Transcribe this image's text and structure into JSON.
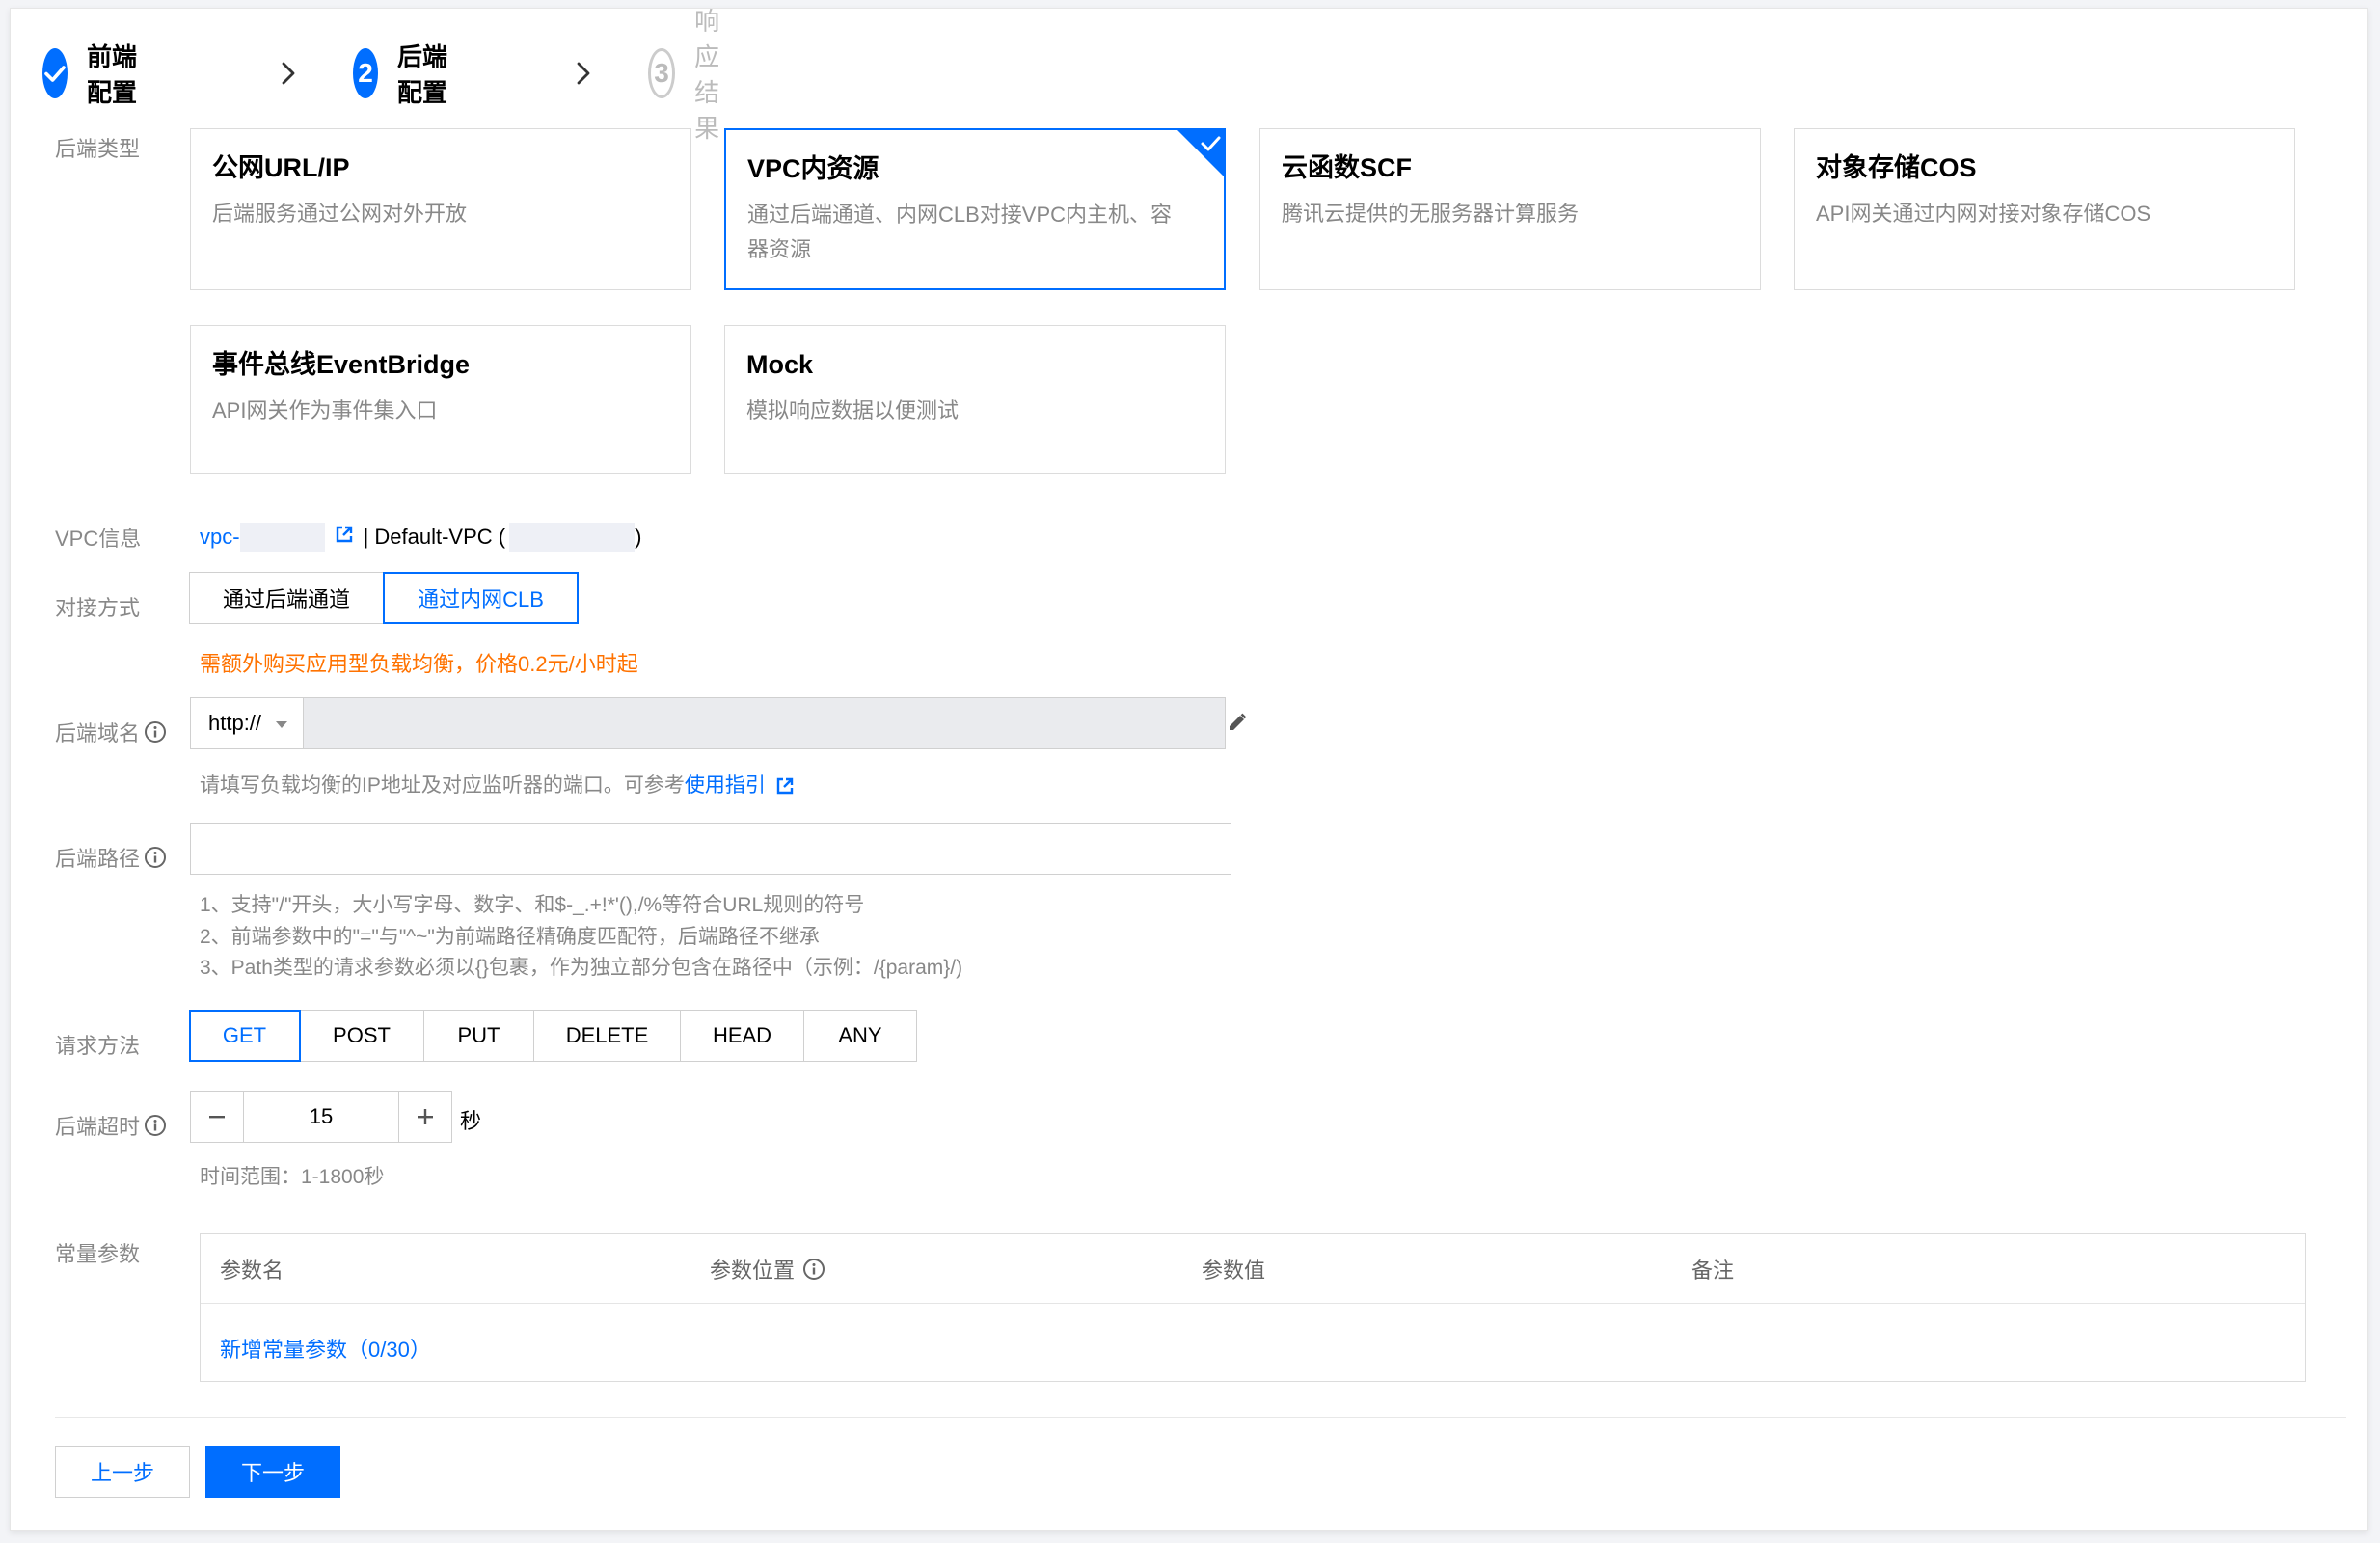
{
  "steps": [
    {
      "number": "",
      "label": "前端配置",
      "status": "done"
    },
    {
      "number": "2",
      "label": "后端配置",
      "status": "active"
    },
    {
      "number": "3",
      "label": "响应结果",
      "status": "pending"
    }
  ],
  "labels": {
    "backend_type": "后端类型",
    "vpc_info": "VPC信息",
    "connect_method": "对接方式",
    "backend_domain": "后端域名",
    "backend_path": "后端路径",
    "request_method": "请求方法",
    "backend_timeout": "后端超时",
    "constant_params": "常量参数"
  },
  "backend_types": [
    {
      "title": "公网URL/IP",
      "desc": "后端服务通过公网对外开放",
      "selected": false
    },
    {
      "title": "VPC内资源",
      "desc": "通过后端通道、内网CLB对接VPC内主机、容器资源",
      "selected": true
    },
    {
      "title": "云函数SCF",
      "desc": "腾讯云提供的无服务器计算服务",
      "selected": false
    },
    {
      "title": "对象存储COS",
      "desc": "API网关通过内网对接对象存储COS",
      "selected": false
    },
    {
      "title": "事件总线EventBridge",
      "desc": "API网关作为事件集入口",
      "selected": false
    },
    {
      "title": "Mock",
      "desc": "模拟响应数据以便测试",
      "selected": false
    }
  ],
  "vpc": {
    "id_prefix": "vpc-",
    "separator_name": "| Default-VPC (",
    "close_paren": ")"
  },
  "connect_methods": [
    {
      "label": "通过后端通道",
      "active": false
    },
    {
      "label": "通过内网CLB",
      "active": true
    }
  ],
  "connect_warning": "需额外购买应用型负载均衡，价格0.2元/小时起",
  "domain": {
    "protocol": "http://",
    "value": "",
    "help_prefix": "请填写负载均衡的IP地址及对应监听器的端口。可参考",
    "help_link": "使用指引"
  },
  "path": {
    "value": "",
    "help": [
      "1、支持\"/\"开头，大小写字母、数字、和$-_.+!*'(),/%等符合URL规则的符号",
      "2、前端参数中的\"=\"与\"^~\"为前端路径精确度匹配符，后端路径不继承",
      "3、Path类型的请求参数必须以{}包裹，作为独立部分包含在路径中（示例：/{param}/)"
    ]
  },
  "methods": [
    {
      "label": "GET",
      "active": true
    },
    {
      "label": "POST",
      "active": false
    },
    {
      "label": "PUT",
      "active": false
    },
    {
      "label": "DELETE",
      "active": false
    },
    {
      "label": "HEAD",
      "active": false
    },
    {
      "label": "ANY",
      "active": false
    }
  ],
  "timeout": {
    "value": "15",
    "unit": "秒",
    "range": "时间范围：1-1800秒"
  },
  "params_table": {
    "headers": [
      "参数名",
      "参数位置",
      "参数值",
      "备注"
    ],
    "add_link": "新增常量参数（0/30）"
  },
  "footer": {
    "prev": "上一步",
    "next": "下一步"
  },
  "colors": {
    "primary": "#006eff",
    "warning": "#ff7200",
    "muted": "#888888"
  }
}
